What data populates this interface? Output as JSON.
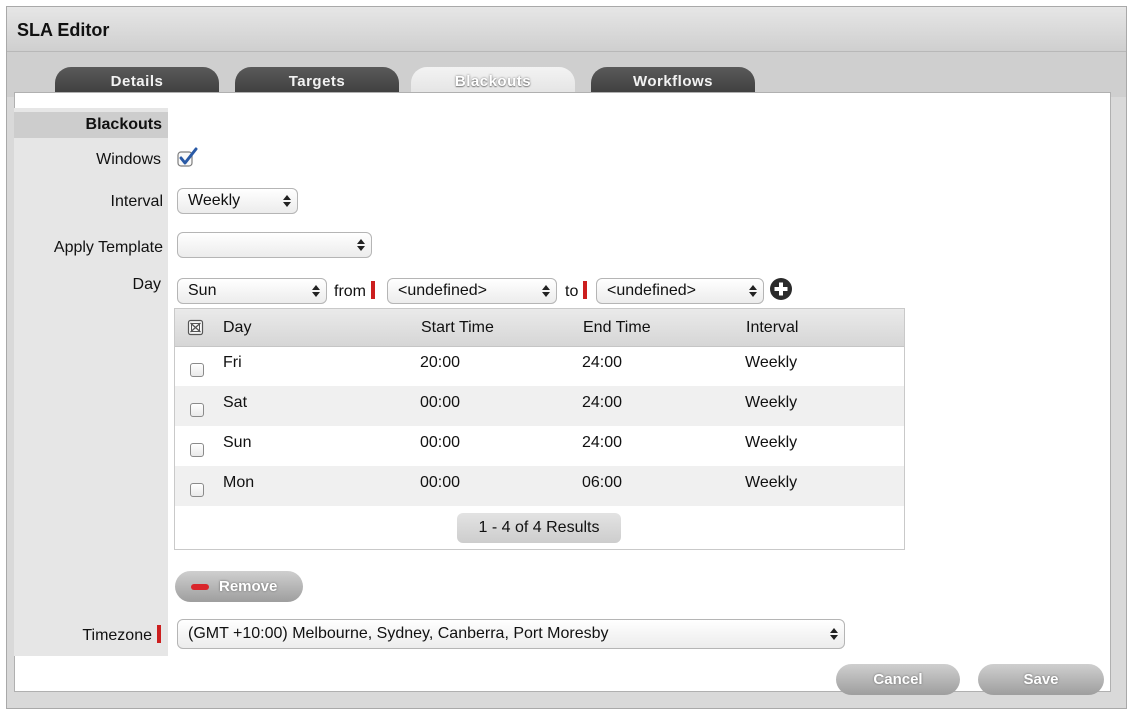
{
  "window": {
    "title": "SLA Editor"
  },
  "tabs": [
    {
      "label": "Details"
    },
    {
      "label": "Targets"
    },
    {
      "label": "Blackouts"
    },
    {
      "label": "Workflows"
    }
  ],
  "active_tab": "Blackouts",
  "form": {
    "section_title": "Blackouts",
    "windows_label": "Windows",
    "windows_checked": true,
    "interval_label": "Interval",
    "interval_value": "Weekly",
    "apply_template_label": "Apply Template",
    "apply_template_value": "",
    "day_label": "Day",
    "day_value": "Sun",
    "from_label": "from",
    "from_value": "<undefined>",
    "to_label": "to",
    "to_value": "<undefined>",
    "timezone_label": "Timezone",
    "timezone_value": "(GMT +10:00) Melbourne, Sydney, Canberra, Port Moresby"
  },
  "table": {
    "columns": [
      "Day",
      "Start Time",
      "End Time",
      "Interval"
    ],
    "rows": [
      [
        "Fri",
        "20:00",
        "24:00",
        "Weekly"
      ],
      [
        "Sat",
        "00:00",
        "24:00",
        "Weekly"
      ],
      [
        "Sun",
        "00:00",
        "24:00",
        "Weekly"
      ],
      [
        "Mon",
        "00:00",
        "06:00",
        "Weekly"
      ]
    ],
    "pager": "1 - 4 of 4 Results"
  },
  "buttons": {
    "remove": "Remove",
    "cancel": "Cancel",
    "save": "Save"
  },
  "icons": {
    "add": "plus-circle-icon",
    "select_arrows": "up-down-arrows-icon"
  },
  "colors": {
    "required_marker": "#cc1f1f",
    "remove_icon": "#d9262c",
    "check_accent": "#2a5aa6"
  }
}
